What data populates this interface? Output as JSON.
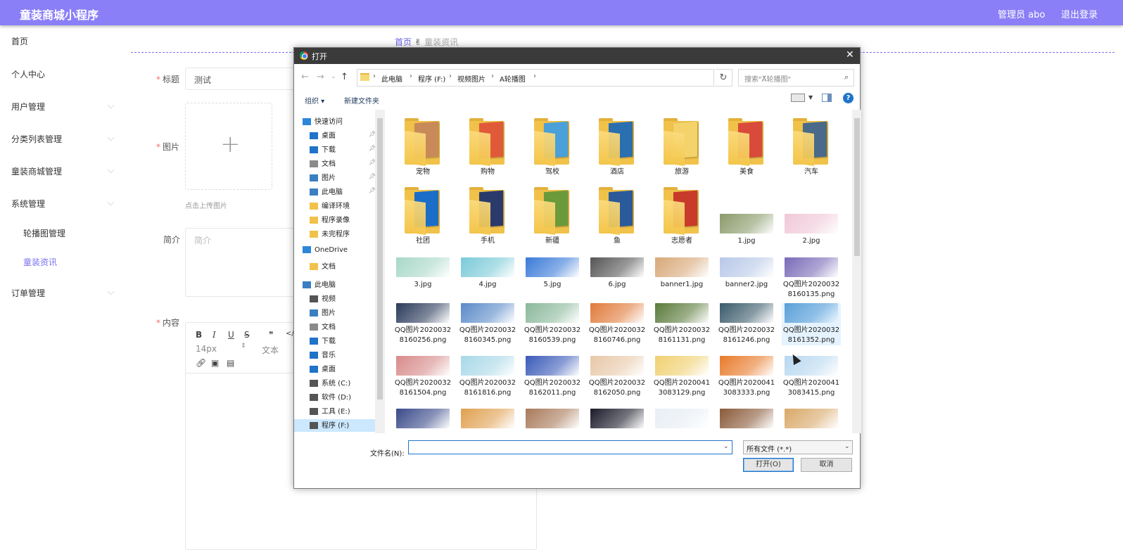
{
  "app": {
    "title": "童装商城小程序",
    "user_label": "管理员 abo",
    "logout": "退出登录"
  },
  "sidebar": {
    "items": [
      {
        "label": "首页"
      },
      {
        "label": "个人中心"
      },
      {
        "label": "用户管理"
      },
      {
        "label": "分类列表管理"
      },
      {
        "label": "童装商城管理"
      },
      {
        "label": "系统管理"
      }
    ],
    "sub_items": [
      {
        "label": "轮播图管理"
      },
      {
        "label": "童装资讯"
      }
    ],
    "last_item": {
      "label": "订单管理"
    }
  },
  "breadcrumb": {
    "home": "首页",
    "current": "童装资讯",
    "separator": "✌"
  },
  "form": {
    "title_label": "标题",
    "title_value": "测试",
    "image_label": "图片",
    "upload_hint": "点击上传图片",
    "intro_label": "简介",
    "intro_placeholder": "简介",
    "content_label": "内容",
    "editor": {
      "bold": "B",
      "italic": "I",
      "underline": "U",
      "strike": "S",
      "quote": "❞",
      "code": "</>",
      "font_size": "14px",
      "text_type": "文本"
    }
  },
  "dialog": {
    "title": "打开",
    "breadcrumbs": [
      "此电脑",
      "程序 (F:)",
      "视频图片",
      "A轮播图"
    ],
    "search_placeholder": "搜索\"A轮播图\"",
    "organize": "组织 ▾",
    "new_folder": "新建文件夹",
    "help": "?",
    "nav": [
      {
        "label": "快速访问",
        "icon": "star-icon",
        "color": "#2b88d8",
        "pin": false
      },
      {
        "label": "桌面",
        "icon": "desktop-icon",
        "color": "#1f73c9",
        "pin": true
      },
      {
        "label": "下载",
        "icon": "download-icon",
        "color": "#1f73c9",
        "pin": true
      },
      {
        "label": "文档",
        "icon": "document-icon",
        "color": "#8a8a8a",
        "pin": true
      },
      {
        "label": "图片",
        "icon": "pictures-icon",
        "color": "#3a7fc1",
        "pin": true
      },
      {
        "label": "此电脑",
        "icon": "computer-icon",
        "color": "#3a7fc1",
        "pin": true
      },
      {
        "label": "编译环境",
        "icon": "folder-icon",
        "color": "#f1c24a",
        "pin": false
      },
      {
        "label": "程序录像",
        "icon": "folder-icon",
        "color": "#f1c24a",
        "pin": false
      },
      {
        "label": "未完程序",
        "icon": "folder-icon",
        "color": "#f1c24a",
        "pin": false
      },
      {
        "label": "OneDrive",
        "icon": "cloud-icon",
        "color": "#2b88d8",
        "pin": false
      },
      {
        "label": "文档",
        "icon": "folder-icon",
        "color": "#f1c24a",
        "pin": false
      },
      {
        "label": "此电脑",
        "icon": "computer-icon",
        "color": "#3a7fc1",
        "pin": false
      },
      {
        "label": "视频",
        "icon": "video-icon",
        "color": "#555555",
        "pin": false
      },
      {
        "label": "图片",
        "icon": "pictures-icon",
        "color": "#3a7fc1",
        "pin": false
      },
      {
        "label": "文档",
        "icon": "document-icon",
        "color": "#8a8a8a",
        "pin": false
      },
      {
        "label": "下载",
        "icon": "download-icon",
        "color": "#1f73c9",
        "pin": false
      },
      {
        "label": "音乐",
        "icon": "music-icon",
        "color": "#1f73c9",
        "pin": false
      },
      {
        "label": "桌面",
        "icon": "desktop-icon",
        "color": "#1f73c9",
        "pin": false
      },
      {
        "label": "系统 (C:)",
        "icon": "drive-icon",
        "color": "#555555",
        "pin": false
      },
      {
        "label": "软件 (D:)",
        "icon": "drive-icon",
        "color": "#555555",
        "pin": false
      },
      {
        "label": "工具 (E:)",
        "icon": "drive-icon",
        "color": "#555555",
        "pin": false
      },
      {
        "label": "程序 (F:)",
        "icon": "drive-icon",
        "color": "#555555",
        "pin": false
      }
    ],
    "folders": [
      {
        "label": "宠物",
        "color": "#c98a5a"
      },
      {
        "label": "购物",
        "color": "#e05a3a"
      },
      {
        "label": "驾校",
        "color": "#4aa0d8"
      },
      {
        "label": "酒店",
        "color": "#2a6fb0"
      },
      {
        "label": "旅游",
        "color": "#f3d36a"
      },
      {
        "label": "美食",
        "color": "#d94a3a"
      },
      {
        "label": "汽车",
        "color": "#4a6a8a"
      },
      {
        "label": "社团",
        "color": "#1a6ec8"
      },
      {
        "label": "手机",
        "color": "#2a3a6a"
      },
      {
        "label": "新疆",
        "color": "#6a9a3a"
      },
      {
        "label": "鱼",
        "color": "#2a5a9a"
      },
      {
        "label": "志愿者",
        "color": "#c83a2a"
      }
    ],
    "images": [
      {
        "label": "1.jpg",
        "color": "#8a9a6a"
      },
      {
        "label": "2.jpg",
        "color": "#f0c8d8"
      },
      {
        "label": "3.jpg",
        "color": "#a8d8c8"
      },
      {
        "label": "4.jpg",
        "color": "#7acad8"
      },
      {
        "label": "5.jpg",
        "color": "#3a7ad8"
      },
      {
        "label": "6.jpg",
        "color": "#555555"
      },
      {
        "label": "banner1.jpg",
        "color": "#d8a878"
      },
      {
        "label": "banner2.jpg",
        "color": "#b8c8e8"
      },
      {
        "label": "QQ图片20200328160135.png",
        "color": "#7a6ab8"
      },
      {
        "label": "QQ图片20200328160256.png",
        "color": "#2a3a5a"
      },
      {
        "label": "QQ图片20200328160345.png",
        "color": "#5a8ac8"
      },
      {
        "label": "QQ图片20200328160539.png",
        "color": "#8ab89a"
      },
      {
        "label": "QQ图片20200328160746.png",
        "color": "#e07a3a"
      },
      {
        "label": "QQ图片20200328161131.png",
        "color": "#5a7a3a"
      },
      {
        "label": "QQ图片20200328161246.png",
        "color": "#3a5a6a"
      },
      {
        "label": "QQ图片20200328161352.png",
        "color": "#5aa0d8"
      },
      {
        "label": "QQ图片20200328161504.png",
        "color": "#d88a8a"
      },
      {
        "label": "QQ图片20200328161816.png",
        "color": "#a8d8e8"
      },
      {
        "label": "QQ图片20200328162011.png",
        "color": "#3a5ab8"
      },
      {
        "label": "QQ图片20200328162050.png",
        "color": "#e8c8a8"
      },
      {
        "label": "QQ图片20200413083129.png",
        "color": "#f0d070"
      },
      {
        "label": "QQ图片20200413083333.png",
        "color": "#e87a2a"
      },
      {
        "label": "QQ图片20200413083415.png",
        "color": "#b8d8f0"
      },
      {
        "label": "",
        "color": "#3a4a8a"
      },
      {
        "label": "",
        "color": "#e0a050"
      },
      {
        "label": "",
        "color": "#a87a5a"
      },
      {
        "label": "",
        "color": "#1a1a2a"
      },
      {
        "label": "",
        "color": "#e8eef4"
      },
      {
        "label": "",
        "color": "#8a5a3a"
      },
      {
        "label": "",
        "color": "#d8a868"
      }
    ],
    "filename_label": "文件名(N):",
    "filename_value": "",
    "filetype": "所有文件 (*.*)",
    "open_button": "打开(O)",
    "cancel_button": "取消"
  }
}
